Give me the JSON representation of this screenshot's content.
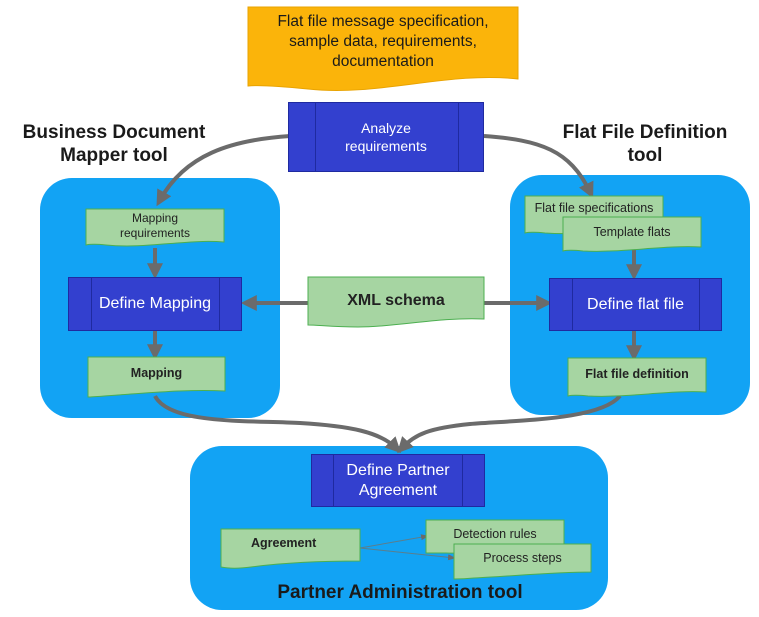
{
  "source_doc": {
    "label": "Flat file message specification, sample data, requirements, documentation",
    "color": "#fbb40a"
  },
  "analyze": {
    "label": "Analyze requirements"
  },
  "left_tool": {
    "title": "Business Document Mapper tool",
    "input_doc": "Mapping requirements",
    "process": "Define Mapping",
    "output_doc": "Mapping"
  },
  "right_tool": {
    "title": "Flat File Definition tool",
    "input_doc_1": "Flat file specifications",
    "input_doc_2": "Template flats",
    "process": "Define flat file",
    "output_doc": "Flat file definition"
  },
  "shared": {
    "xml_schema": "XML schema"
  },
  "bottom_tool": {
    "title": "Partner Administration tool",
    "process": "Define Partner Agreement",
    "agreement": "Agreement",
    "detection_rules": "Detection rules",
    "process_steps": "Process steps"
  },
  "colors": {
    "panel": "#12a3f4",
    "process": "#3340cf",
    "document": "#a6d5a2",
    "arrow": "#6b6b6b"
  }
}
